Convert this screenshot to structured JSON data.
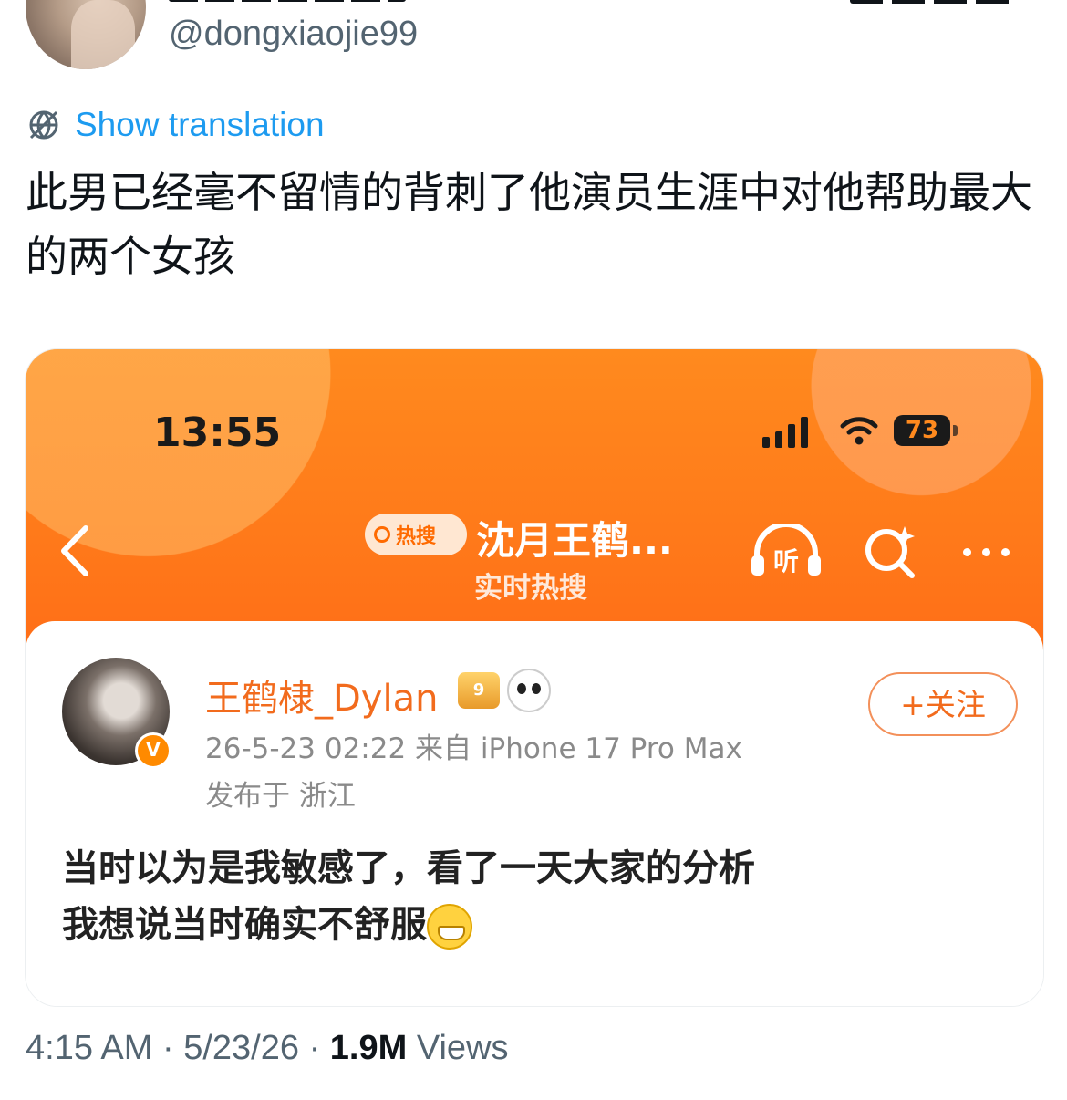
{
  "tweet": {
    "handle": "@dongxiaojie99",
    "translate_label": "Show translation",
    "text": "此男已经毫不留情的背刺了他演员生涯中对他帮助最大的两个女孩",
    "time": "4:15 AM",
    "date": "5/23/26",
    "sep": "·",
    "views_count": "1.9M",
    "views_label": "Views"
  },
  "screenshot": {
    "status": {
      "time": "13:55",
      "battery": "73"
    },
    "nav": {
      "hot_search_badge": "热搜",
      "title": "沈月王鹤...",
      "subtitle": "实时热搜",
      "listen_label": "听"
    },
    "post": {
      "author": "王鹤棣_Dylan",
      "crown_badge": "9",
      "verified": "V",
      "follow_label": "+关注",
      "meta": "26-5-23 02:22  来自 iPhone 17 Pro Max",
      "location": "发布于 浙江",
      "body_line1": "当时以为是我敏感了，看了一天大家的分析",
      "body_line2": "我想说当时确实不舒服"
    }
  },
  "colors": {
    "link_blue": "#1d9bf0",
    "weibo_orange": "#ff7a1a",
    "author_orange": "#f26b1d"
  }
}
